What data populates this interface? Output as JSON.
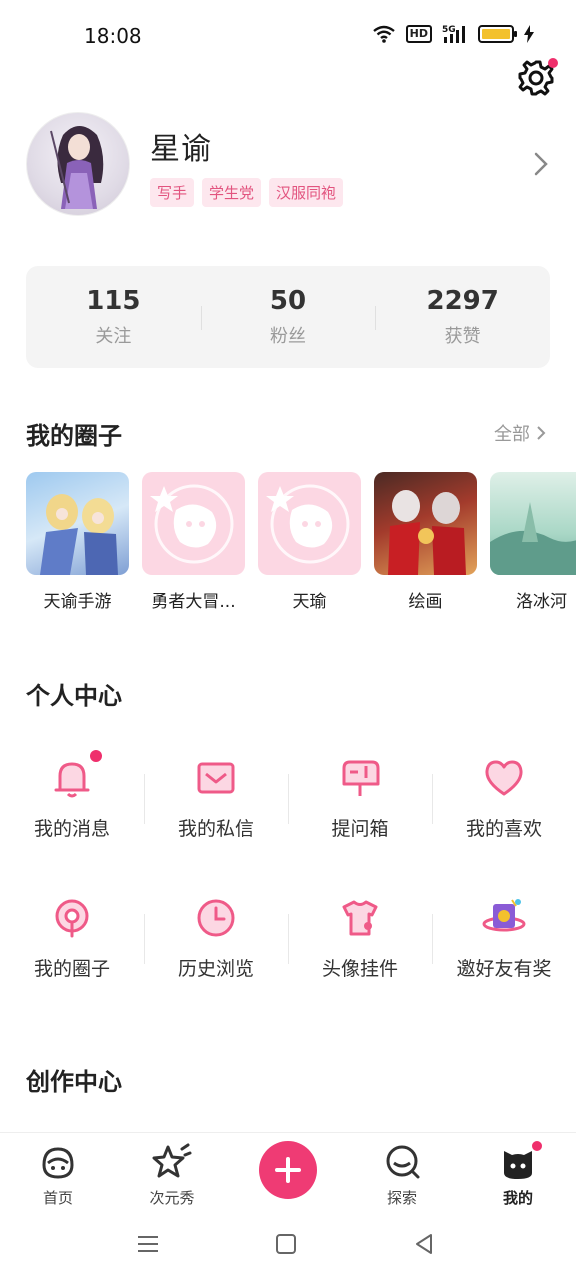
{
  "status_bar": {
    "time": "18:08",
    "hd": "HD",
    "network": "5G"
  },
  "profile": {
    "nickname": "星谕",
    "tags": [
      "写手",
      "学生党",
      "汉服同袍"
    ]
  },
  "stats": [
    {
      "value": "115",
      "label": "关注"
    },
    {
      "value": "50",
      "label": "粉丝"
    },
    {
      "value": "2297",
      "label": "获赞"
    }
  ],
  "my_circles": {
    "title": "我的圈子",
    "more_label": "全部",
    "items": [
      {
        "name": "天谕手游"
      },
      {
        "name": "勇者大冒..."
      },
      {
        "name": "天瑜"
      },
      {
        "name": "绘画"
      },
      {
        "name": "洛冰河"
      }
    ]
  },
  "personal_center": {
    "title": "个人中心",
    "row1": [
      {
        "label": "我的消息",
        "icon": "bell-icon"
      },
      {
        "label": "我的私信",
        "icon": "mail-icon"
      },
      {
        "label": "提问箱",
        "icon": "mailbox-icon"
      },
      {
        "label": "我的喜欢",
        "icon": "heart-icon"
      }
    ],
    "row2": [
      {
        "label": "我的圈子",
        "icon": "circle-pin-icon"
      },
      {
        "label": "历史浏览",
        "icon": "clock-icon"
      },
      {
        "label": "头像挂件",
        "icon": "tshirt-icon"
      },
      {
        "label": "邀好友有奖",
        "icon": "gift-planet-icon"
      }
    ]
  },
  "creation_center": {
    "title": "创作中心"
  },
  "bottom_nav": [
    {
      "label": "首页"
    },
    {
      "label": "次元秀"
    },
    {
      "label": "探索"
    },
    {
      "label": "我的"
    }
  ],
  "colors": {
    "accent": "#ef3b74",
    "tag_bg": "#fde7ee",
    "tag_text": "#e2547f",
    "badge": "#ef2f6c"
  }
}
